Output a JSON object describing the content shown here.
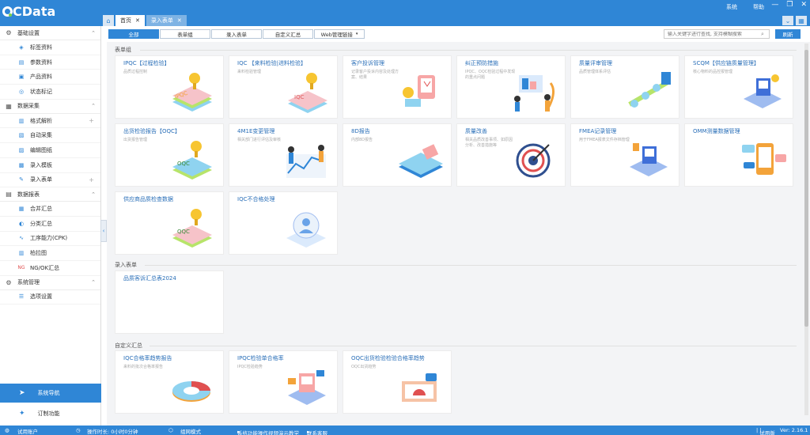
{
  "app": {
    "logo_q": "Q",
    "logo_rest": "CData"
  },
  "topmenu": [
    "系统",
    "帮助"
  ],
  "tabs": [
    {
      "label": "首页",
      "active": true
    },
    {
      "label": "录入表单",
      "active": false
    }
  ],
  "sidebar": {
    "groups": [
      {
        "label": "基础设置",
        "icon": "gear-icon",
        "items": [
          {
            "label": "标签资料",
            "icon": "tag-icon"
          },
          {
            "label": "参数资料",
            "icon": "list-icon"
          },
          {
            "label": "产品资料",
            "icon": "box-icon"
          },
          {
            "label": "状态标记",
            "icon": "flag-icon"
          }
        ]
      },
      {
        "label": "数据采集",
        "icon": "database-icon",
        "items": [
          {
            "label": "格式解析",
            "icon": "format-icon",
            "plus": true
          },
          {
            "label": "自动采集",
            "icon": "auto-icon"
          },
          {
            "label": "编辑图纸",
            "icon": "drawing-icon"
          },
          {
            "label": "录入模板",
            "icon": "template-icon"
          },
          {
            "label": "录入表单",
            "icon": "form-icon",
            "plus": true
          }
        ]
      },
      {
        "label": "数据报表",
        "icon": "report-icon",
        "items": [
          {
            "label": "合并汇总",
            "icon": "merge-icon"
          },
          {
            "label": "分类汇总",
            "icon": "classify-icon"
          },
          {
            "label": "工序能力(CPK)",
            "icon": "cpk-icon"
          },
          {
            "label": "柏拉图",
            "icon": "pareto-icon"
          },
          {
            "label": "NG/OK汇总",
            "icon": "ng-icon"
          }
        ]
      },
      {
        "label": "系统管理",
        "icon": "system-icon",
        "items": [
          {
            "label": "选项设置",
            "icon": "options-icon"
          }
        ]
      }
    ],
    "nav_button": "系统导航",
    "custom_button": "订制功能"
  },
  "filter": {
    "buttons": [
      "全部",
      "表单组",
      "录入表单",
      "自定义汇总",
      "Web管理链接"
    ],
    "search_placeholder": "输入关键字进行查找, 支持模糊搜索",
    "refresh": "刷新"
  },
  "sections": {
    "form_group": {
      "title": "表单组",
      "cards": [
        {
          "title": "IPQC【过程检验】",
          "desc": "品质过程控制",
          "ill": "ipqc"
        },
        {
          "title": "IQC 【来料检验|进料检验】",
          "desc": "来料检验管理",
          "ill": "iqc"
        },
        {
          "title": "客户投诉管理",
          "desc": "记录客户投诉内容及处理方案、结果",
          "ill": "complaint"
        },
        {
          "title": "纠正预防措施",
          "desc": "IPQC、OQC检验过程中发现的重点问题",
          "ill": "team"
        },
        {
          "title": "质量评审管理",
          "desc": "品质管理体系评估",
          "ill": "flow"
        },
        {
          "title": "SCQM【供应链质量管理】",
          "desc": "核心物料的品控报管理",
          "ill": "isometric"
        },
        {
          "title": "出货检验报告【OQC】",
          "desc": "出货报告管理",
          "ill": "oqc"
        },
        {
          "title": "4M1E变更管理",
          "desc": "相关部门进行评估及审核",
          "ill": "chart"
        },
        {
          "title": "8D报告",
          "desc": "内部8D报告",
          "ill": "book"
        },
        {
          "title": "质量改善",
          "desc": "相关品质改善事项、如原因分析、改善措施等",
          "ill": "target"
        },
        {
          "title": "FMEA记录管理",
          "desc": "用于FMEA报表文件存档管理",
          "ill": "isometric2"
        },
        {
          "title": "OMM测量数据管理",
          "desc": "",
          "ill": "phone"
        },
        {
          "title": "供应商品质检查数据",
          "desc": "",
          "ill": "supplier"
        },
        {
          "title": "IQC不合格处理",
          "desc": "",
          "ill": "user"
        }
      ]
    },
    "entry_form": {
      "title": "录入表单",
      "cards": [
        {
          "title": "品质客诉汇总表2024"
        }
      ]
    },
    "custom_summary": {
      "title": "自定义汇总",
      "cards": [
        {
          "title": "IQC合格率趋势报告",
          "desc": "来料的批次合格率报告",
          "ill": "donut"
        },
        {
          "title": "IPQC检验单合格率",
          "desc": "IPQC检验趋势",
          "ill": "isometric3"
        },
        {
          "title": "OQC出货检验检验合格率趋势",
          "desc": "OQC出货趋势",
          "ill": "alarm"
        }
      ]
    }
  },
  "statusbar": {
    "user": "试用账户",
    "runtime": "操作时长: 0小时0分钟",
    "mode": "组网模式",
    "link1": "系统功能操作视频演示教学",
    "link2": "联系客服",
    "version_label": "试用版",
    "version": "Ver: 2.16.1"
  },
  "colors": {
    "primary": "#2f86d6",
    "card_title": "#2a6fb8"
  }
}
